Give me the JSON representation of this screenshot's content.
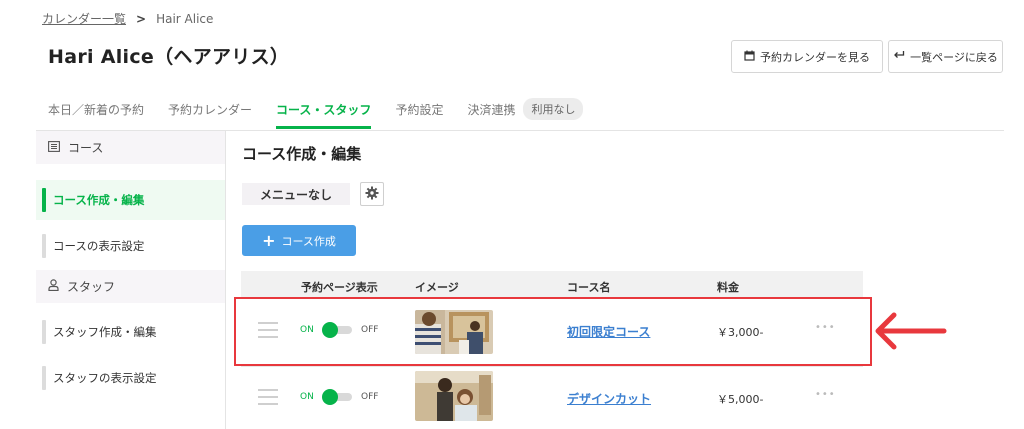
{
  "breadcrumb": {
    "link": "カレンダー一覧",
    "separator": ">",
    "current": "Hair Alice"
  },
  "page_title": "Hari Alice（ヘアアリス）",
  "header_buttons": {
    "calendar": "予約カレンダーを見る",
    "back": "一覧ページに戻る"
  },
  "tabs": [
    {
      "label": "本日／新着の予約"
    },
    {
      "label": "予約カレンダー"
    },
    {
      "label": "コース・スタッフ",
      "active": true
    },
    {
      "label": "予約設定"
    },
    {
      "label": "決済連携",
      "badge": "利用なし"
    }
  ],
  "sidebar": {
    "course_header": "コース",
    "course_items": [
      {
        "label": "コース作成・編集",
        "active": true
      },
      {
        "label": "コースの表示設定"
      }
    ],
    "staff_header": "スタッフ",
    "staff_items": [
      {
        "label": "スタッフ作成・編集"
      },
      {
        "label": "スタッフの表示設定"
      }
    ]
  },
  "main": {
    "title": "コース作成・編集",
    "menu_name": "メニューなし",
    "add_button": "コース作成",
    "columns": {
      "visibility": "予約ページ表示",
      "image": "イメージ",
      "name": "コース名",
      "price": "料金"
    },
    "rows": [
      {
        "on": "ON",
        "off": "OFF",
        "name": "初回限定コース",
        "price": "￥3,000-",
        "more": "•••"
      },
      {
        "on": "ON",
        "off": "OFF",
        "name": "デザインカット",
        "price": "￥5,000-",
        "more": "•••"
      }
    ]
  },
  "colors": {
    "accent_green": "#06b34a",
    "link_blue": "#3b7fd0",
    "button_blue": "#4a9ee6",
    "highlight_red": "#e8383d"
  },
  "icons": [
    "calendar-icon",
    "return-arrow-icon",
    "list-icon",
    "person-icon",
    "gear-icon",
    "plus-icon",
    "drag-handle-icon",
    "more-icon",
    "red-arrow-icon"
  ]
}
